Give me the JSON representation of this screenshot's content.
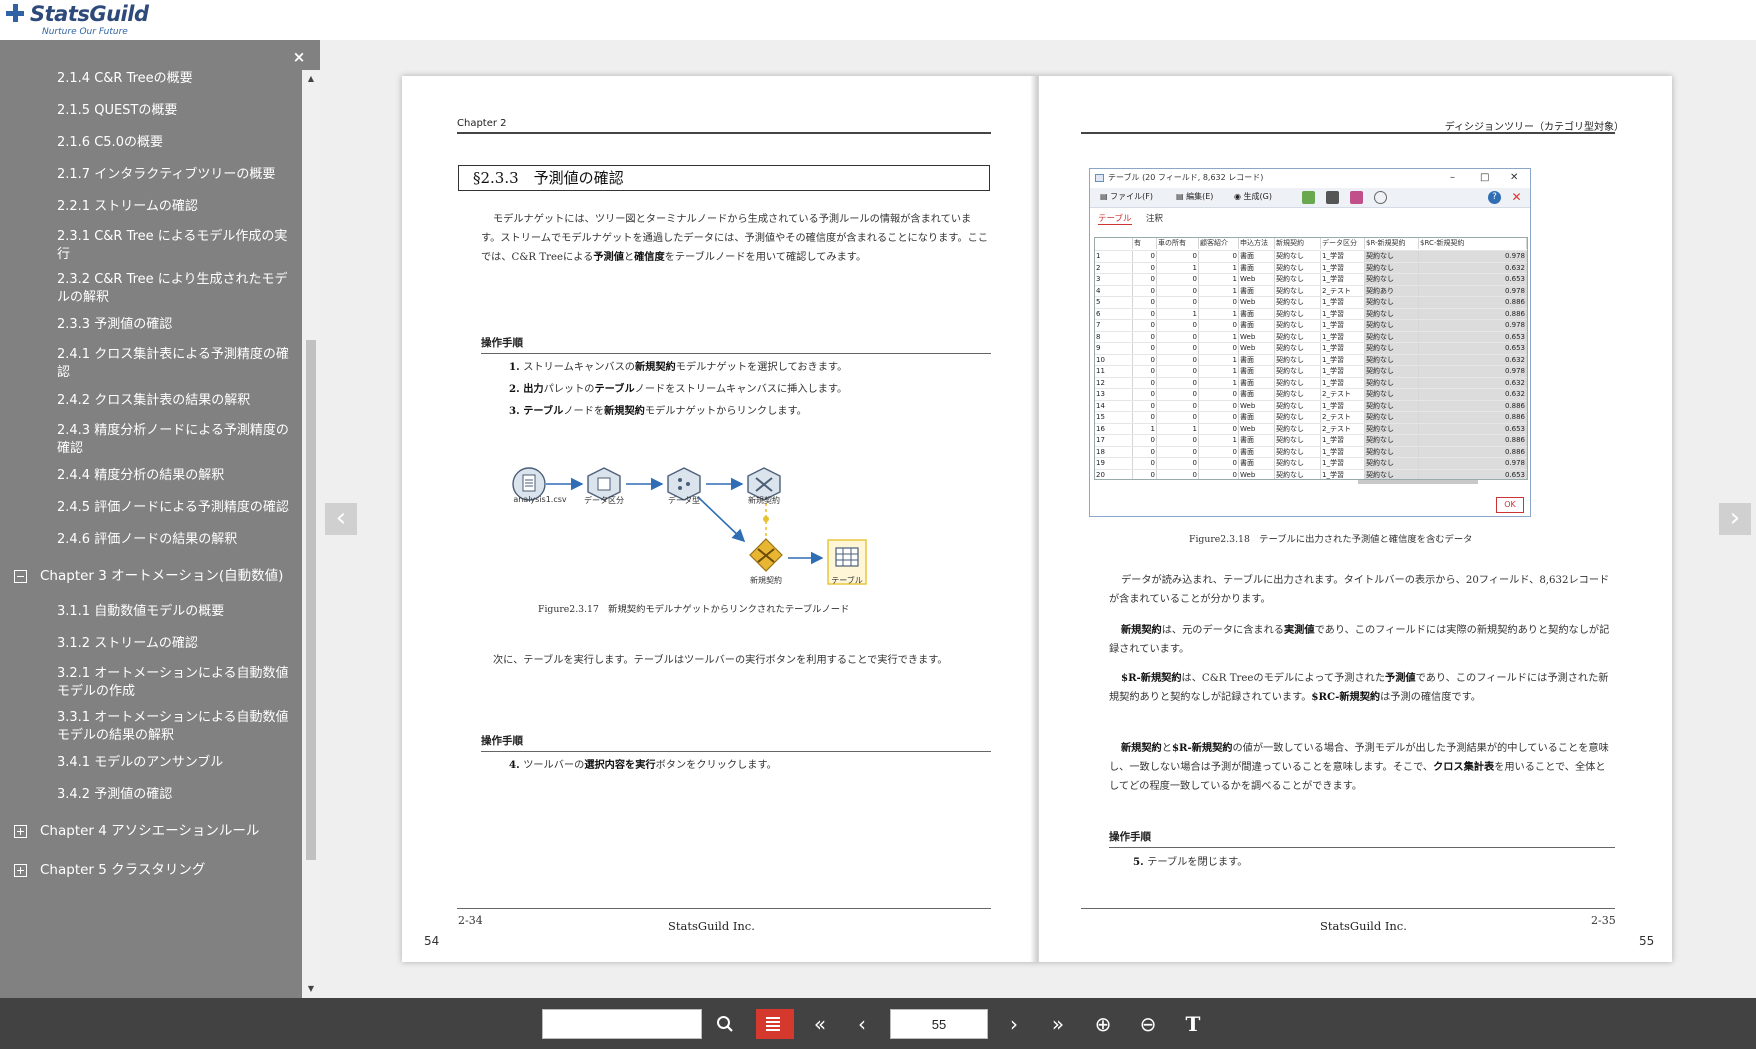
{
  "brand": {
    "name": "StatsGuild",
    "tagline": "Nurture Our Future"
  },
  "sidebar": {
    "close_glyph": "×",
    "items": [
      {
        "label": "2.1.4 C&R Treeの概要",
        "kind": "sub"
      },
      {
        "label": "2.1.5 QUESTの概要",
        "kind": "sub"
      },
      {
        "label": "2.1.6 C5.0の概要",
        "kind": "sub"
      },
      {
        "label": "2.1.7 インタラクティブツリーの概要",
        "kind": "sub"
      },
      {
        "label": "2.2.1 ストリームの確認",
        "kind": "sub"
      },
      {
        "label": "2.3.1 C&R Tree によるモデル作成の実行",
        "kind": "sub"
      },
      {
        "label": "2.3.2 C&R Tree により生成されたモデルの解釈",
        "kind": "sub"
      },
      {
        "label": "2.3.3 予測値の確認",
        "kind": "sub"
      },
      {
        "label": "2.4.1 クロス集計表による予測精度の確認",
        "kind": "sub"
      },
      {
        "label": "2.4.2 クロス集計表の結果の解釈",
        "kind": "sub"
      },
      {
        "label": "2.4.3 精度分析ノードによる予測精度の確認",
        "kind": "sub"
      },
      {
        "label": "2.4.4 精度分析の結果の解釈",
        "kind": "sub"
      },
      {
        "label": "2.4.5 評価ノードによる予測精度の確認",
        "kind": "sub"
      },
      {
        "label": "2.4.6 評価ノードの結果の解釈",
        "kind": "sub"
      },
      {
        "label": "Chapter 3 オートメーション(自動数値)",
        "kind": "chapter-open"
      },
      {
        "label": "3.1.1 自動数値モデルの概要",
        "kind": "sub"
      },
      {
        "label": "3.1.2 ストリームの確認",
        "kind": "sub"
      },
      {
        "label": "3.2.1 オートメーションによる自動数値モデルの作成",
        "kind": "sub"
      },
      {
        "label": "3.3.1 オートメーションによる自動数値モデルの結果の解釈",
        "kind": "sub"
      },
      {
        "label": "3.4.1 モデルのアンサンブル",
        "kind": "sub"
      },
      {
        "label": "3.4.2 予測値の確認",
        "kind": "sub"
      },
      {
        "label": "Chapter 4 アソシエーションルール",
        "kind": "chapter-closed"
      },
      {
        "label": "Chapter 5 クラスタリング",
        "kind": "chapter-closed"
      }
    ]
  },
  "left_page": {
    "running_head": "Chapter 2",
    "section_title": "§2.3.3　予測値の確認",
    "intro": [
      {
        "t": "モデルナゲットには、ツリー図とターミナルノードから生成されている予測ルールの情報が含まれています。ストリームでモデルナゲットを通過したデータには、予測値やその確信度が含まれることになります。ここでは、C&R Treeによる"
      },
      {
        "t": "予測値",
        "b": true
      },
      {
        "t": "と"
      },
      {
        "t": "確信度",
        "b": true
      },
      {
        "t": "をテーブルノードを用いて確認してみます。"
      }
    ],
    "proc1_heading": "操作手順",
    "steps1": [
      {
        "n": "1.",
        "parts": [
          {
            "t": "ストリームキャンバスの"
          },
          {
            "t": "新規契約",
            "b": true
          },
          {
            "t": "モデルナゲットを選択しておきます。"
          }
        ]
      },
      {
        "n": "2.",
        "parts": [
          {
            "t": "出力",
            "b": true
          },
          {
            "t": "パレットの"
          },
          {
            "t": "テーブル",
            "b": true
          },
          {
            "t": "ノードをストリームキャンバスに挿入します。"
          }
        ]
      },
      {
        "n": "3.",
        "parts": [
          {
            "t": "テーブル",
            "b": true
          },
          {
            "t": "ノードを"
          },
          {
            "t": "新規契約",
            "b": true
          },
          {
            "t": "モデルナゲットからリンクします。"
          }
        ]
      }
    ],
    "diagram_nodes": {
      "csv": "analysis1.csv",
      "partition": "データ区分",
      "type": "データ型",
      "model": "新規契約",
      "nugget": "新規契約",
      "table": "テーブル"
    },
    "figure_caption": "Figure2.3.17　新規契約モデルナゲットからリンクされたテーブルノード",
    "para2": "次に、テーブルを実行します。テーブルはツールバーの実行ボタンを利用することで実行できます。",
    "proc2_heading": "操作手順",
    "step4": {
      "n": "4.",
      "parts": [
        {
          "t": "ツールバーの"
        },
        {
          "t": "選択内容を実行",
          "b": true
        },
        {
          "t": "ボタンをクリックします。"
        }
      ]
    },
    "footer_code": "2-34",
    "footer_company": "StatsGuild Inc.",
    "page_number": "54"
  },
  "right_page": {
    "running_head": "ディシジョンツリー（カテゴリ型対象）",
    "window": {
      "title": "テーブル (20 フィールド, 8,632 レコード)",
      "controls": [
        "–",
        "□",
        "✕"
      ],
      "menu": [
        "ファイル(F)",
        "編集(E)",
        "生成(G)"
      ],
      "tabs": [
        "テーブル",
        "注釈"
      ],
      "columns": [
        "",
        "有",
        "車の所有",
        "顧客紹介",
        "申込方法",
        "新規契約",
        "データ区分",
        "$R-新規契約",
        "$RC-新規契約"
      ],
      "rows": [
        [
          "1",
          "0",
          "0",
          "0",
          "書面",
          "契約なし",
          "1_学習",
          "契約なし",
          "0.978"
        ],
        [
          "2",
          "0",
          "1",
          "1",
          "書面",
          "契約なし",
          "1_学習",
          "契約なし",
          "0.632"
        ],
        [
          "3",
          "0",
          "0",
          "1",
          "Web",
          "契約なし",
          "1_学習",
          "契約なし",
          "0.653"
        ],
        [
          "4",
          "0",
          "0",
          "1",
          "書面",
          "契約なし",
          "2_テスト",
          "契約あり",
          "0.978"
        ],
        [
          "5",
          "0",
          "0",
          "0",
          "Web",
          "契約なし",
          "1_学習",
          "契約なし",
          "0.886"
        ],
        [
          "6",
          "0",
          "1",
          "1",
          "書面",
          "契約なし",
          "1_学習",
          "契約なし",
          "0.886"
        ],
        [
          "7",
          "0",
          "0",
          "0",
          "書面",
          "契約なし",
          "1_学習",
          "契約なし",
          "0.978"
        ],
        [
          "8",
          "0",
          "0",
          "1",
          "Web",
          "契約なし",
          "1_学習",
          "契約なし",
          "0.653"
        ],
        [
          "9",
          "0",
          "0",
          "0",
          "Web",
          "契約なし",
          "1_学習",
          "契約なし",
          "0.653"
        ],
        [
          "10",
          "0",
          "0",
          "1",
          "書面",
          "契約なし",
          "1_学習",
          "契約なし",
          "0.632"
        ],
        [
          "11",
          "0",
          "0",
          "1",
          "書面",
          "契約なし",
          "1_学習",
          "契約なし",
          "0.978"
        ],
        [
          "12",
          "0",
          "0",
          "1",
          "書面",
          "契約なし",
          "1_学習",
          "契約なし",
          "0.632"
        ],
        [
          "13",
          "0",
          "0",
          "0",
          "書面",
          "契約なし",
          "2_テスト",
          "契約なし",
          "0.632"
        ],
        [
          "14",
          "0",
          "0",
          "0",
          "Web",
          "契約なし",
          "1_学習",
          "契約なし",
          "0.886"
        ],
        [
          "15",
          "0",
          "0",
          "0",
          "書面",
          "契約なし",
          "2_テスト",
          "契約なし",
          "0.886"
        ],
        [
          "16",
          "1",
          "1",
          "0",
          "Web",
          "契約なし",
          "2_テスト",
          "契約なし",
          "0.653"
        ],
        [
          "17",
          "0",
          "0",
          "1",
          "書面",
          "契約なし",
          "1_学習",
          "契約なし",
          "0.886"
        ],
        [
          "18",
          "0",
          "0",
          "0",
          "書面",
          "契約なし",
          "1_学習",
          "契約なし",
          "0.886"
        ],
        [
          "19",
          "0",
          "0",
          "0",
          "書面",
          "契約なし",
          "1_学習",
          "契約なし",
          "0.978"
        ],
        [
          "20",
          "0",
          "0",
          "0",
          "Web",
          "契約なし",
          "1_学習",
          "契約なし",
          "0.653"
        ]
      ],
      "ok_label": "OK"
    },
    "figure_caption": "Figure2.3.18　テーブルに出力された予測値と確信度を含むデータ",
    "paras": [
      [
        {
          "t": "データが読み込まれ、テーブルに出力されます。タイトルバーの表示から、20フィールド、8,632レコードが含まれていることが分かります。"
        }
      ],
      [
        {
          "t": "新規契約",
          "b": true
        },
        {
          "t": "は、元のデータに含まれる"
        },
        {
          "t": "実測値",
          "b": true
        },
        {
          "t": "であり、このフィールドには実際の新規契約ありと契約なしが記録されています。"
        }
      ],
      [
        {
          "t": "$R-新規契約",
          "b": true
        },
        {
          "t": "は、C&R Treeのモデルによって予測された"
        },
        {
          "t": "予測値",
          "b": true
        },
        {
          "t": "であり、このフィールドには予測された新規契約ありと契約なしが記録されています。"
        },
        {
          "t": "$RC-新規契約",
          "b": true
        },
        {
          "t": "は予測の確信度です。"
        }
      ],
      [
        {
          "t": "新規契約",
          "b": true
        },
        {
          "t": "と"
        },
        {
          "t": "$R-新規契約",
          "b": true
        },
        {
          "t": "の値が一致している場合、予測モデルが出した予測結果が的中していることを意味し、一致しない場合は予測が間違っていることを意味します。そこで、"
        },
        {
          "t": "クロス集計表",
          "b": true
        },
        {
          "t": "を用いることで、全体としてどの程度一致しているかを調べることができます。"
        }
      ]
    ],
    "proc_heading": "操作手順",
    "step5": {
      "n": "5.",
      "parts": [
        {
          "t": "テーブルを閉じます。"
        }
      ]
    },
    "footer_code": "2-35",
    "footer_company": "StatsGuild Inc.",
    "page_number": "55"
  },
  "nav": {
    "prev_glyph": "‹",
    "next_glyph": "›"
  },
  "toolbar": {
    "search_value": "",
    "page_value": "55",
    "icons": [
      "search-icon",
      "toc-list-icon",
      "first-page-icon",
      "prev-page-icon",
      "next-page-icon",
      "last-page-icon",
      "zoom-in-icon",
      "zoom-out-icon",
      "text-icon"
    ],
    "accent_color": "#d5382d"
  }
}
